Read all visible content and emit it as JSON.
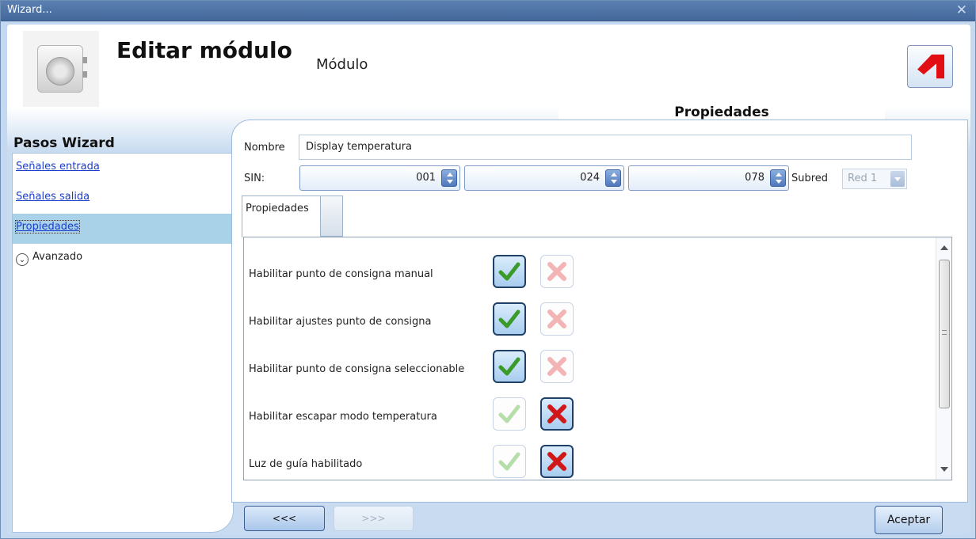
{
  "window": {
    "title": "Wizard...",
    "close_glyph": "✕"
  },
  "header": {
    "title": "Editar módulo",
    "subtitle": "Módulo"
  },
  "top_tab": {
    "label": "Propiedades"
  },
  "steps": {
    "title": "Pasos Wizard",
    "items": [
      {
        "label": "Señales entrada"
      },
      {
        "label": "Señales salida"
      },
      {
        "label": "Propiedades",
        "active": true
      },
      {
        "label": "Avanzado",
        "icon": "chevron-down-circle-icon"
      }
    ]
  },
  "form": {
    "name_label": "Nombre",
    "name_value": "Display temperatura",
    "sin_label": "SIN:",
    "sin_values": [
      "001",
      "024",
      "078"
    ],
    "subnet_label": "Subred",
    "subnet_value": "Red 1"
  },
  "inner_tab": {
    "label": "Propiedades"
  },
  "properties": [
    {
      "label": "Habilitar punto de consigna manual",
      "enabled": true
    },
    {
      "label": "Habilitar ajustes punto de consigna",
      "enabled": true
    },
    {
      "label": "Habilitar punto de consigna seleccionable",
      "enabled": true
    },
    {
      "label": "Habilitar escapar modo temperatura",
      "enabled": false
    },
    {
      "label": "Luz de guía habilitado",
      "enabled": false
    }
  ],
  "footer": {
    "prev_label": "<<<",
    "next_label": ">>>",
    "accept_label": "Aceptar"
  },
  "colors": {
    "accent": "#4e78bd",
    "brand_red": "#e10f14",
    "active_step": "#a9d1e8"
  }
}
